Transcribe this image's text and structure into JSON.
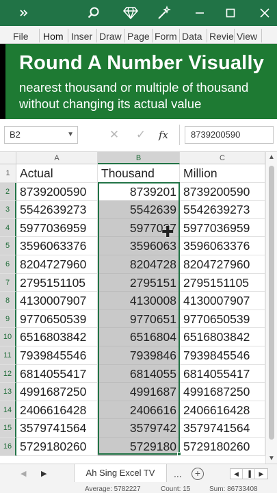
{
  "title_bar": {
    "icons": [
      "chevron-double-right-icon",
      "search-icon",
      "diamond-icon",
      "magic-wand-icon",
      "minimize-icon",
      "maximize-icon",
      "close-icon"
    ]
  },
  "ribbon": {
    "tabs": [
      "File",
      "Hom",
      "Inser",
      "Draw",
      "Page",
      "Form",
      "Data",
      "Revie",
      "View"
    ],
    "active": "Hom"
  },
  "banner": {
    "title": "Round A Number Visually",
    "line1": "nearest thousand or multiple of thousand",
    "line2": "without changing its actual value"
  },
  "formula_bar": {
    "name_box": "B2",
    "cancel_symbol": "✕",
    "enter_symbol": "✓",
    "fx_label": "fx",
    "value": "8739200590"
  },
  "columns": [
    "A",
    "B",
    "C"
  ],
  "table": {
    "headers": [
      "Actual",
      "Thousand",
      "Million"
    ],
    "row_numbers": [
      "1",
      "2",
      "3",
      "4",
      "5",
      "6",
      "7",
      "8",
      "9",
      "10",
      "11",
      "12",
      "13",
      "14",
      "15",
      "16"
    ],
    "rows": [
      [
        "8739200590",
        "8739201",
        "8739200590"
      ],
      [
        "5542639273",
        "5542639",
        "5542639273"
      ],
      [
        "5977036959",
        "5977037",
        "5977036959"
      ],
      [
        "3596063376",
        "3596063",
        "3596063376"
      ],
      [
        "8204727960",
        "8204728",
        "8204727960"
      ],
      [
        "2795151105",
        "2795151",
        "2795151105"
      ],
      [
        "4130007907",
        "4130008",
        "4130007907"
      ],
      [
        "9770650539",
        "9770651",
        "9770650539"
      ],
      [
        "6516803842",
        "6516804",
        "6516803842"
      ],
      [
        "7939845546",
        "7939846",
        "7939845546"
      ],
      [
        "6814055417",
        "6814055",
        "6814055417"
      ],
      [
        "4991687250",
        "4991687",
        "4991687250"
      ],
      [
        "2406616428",
        "2406616",
        "2406616428"
      ],
      [
        "3579741564",
        "3579742",
        "3579741564"
      ],
      [
        "5729180260",
        "5729180",
        "5729180260"
      ]
    ]
  },
  "sheet_tabs": {
    "prev": "◀",
    "next": "▶",
    "active_sheet": "Ah Sing Excel TV",
    "more": "...",
    "add": "+"
  },
  "status_bar": {
    "average": "Average: 5782227",
    "count": "Count: 15",
    "sum": "Sum: 86733408"
  },
  "colors": {
    "excel_green": "#217346",
    "banner_green": "#1e7a33",
    "selection_fill": "#c9c9c9"
  }
}
